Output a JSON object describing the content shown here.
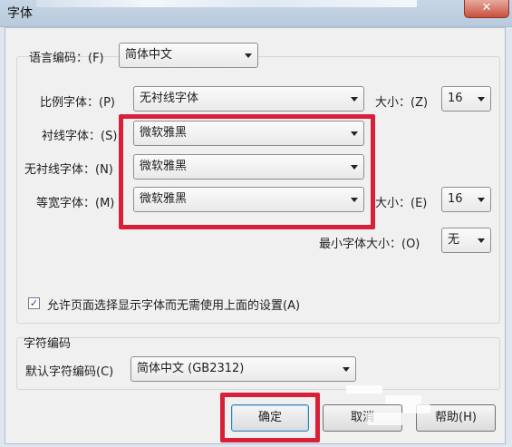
{
  "window": {
    "title": "字体",
    "close_symbol": "✕"
  },
  "language": {
    "label": "语言编码：(F)",
    "value": "简体中文"
  },
  "proportional": {
    "label": "比例字体：(P)",
    "value": "无衬线字体",
    "size_label": "大小：(Z)",
    "size_value": "16"
  },
  "serif": {
    "label": "衬线字体：(S)",
    "value": "微软雅黑"
  },
  "sans_serif": {
    "label": "无衬线字体：(N)",
    "value": "微软雅黑"
  },
  "monospace": {
    "label": "等宽字体：(M)",
    "value": "微软雅黑",
    "size_label": "大小：(E)",
    "size_value": "16"
  },
  "minimum": {
    "label": "最小字体大小：(O)",
    "value": "无"
  },
  "allow_fonts": {
    "label": "允许页面选择显示字体而无需使用上面的设置(A)",
    "checked": true,
    "check_glyph": "✓"
  },
  "encoding": {
    "group_label": "字符编码",
    "label": "默认字符编码(C)",
    "value": "简体中文 (GB2312)"
  },
  "buttons": {
    "ok": "确定",
    "cancel": "取消",
    "help": "帮助(H)"
  },
  "colors": {
    "highlight": "#d9203a"
  }
}
